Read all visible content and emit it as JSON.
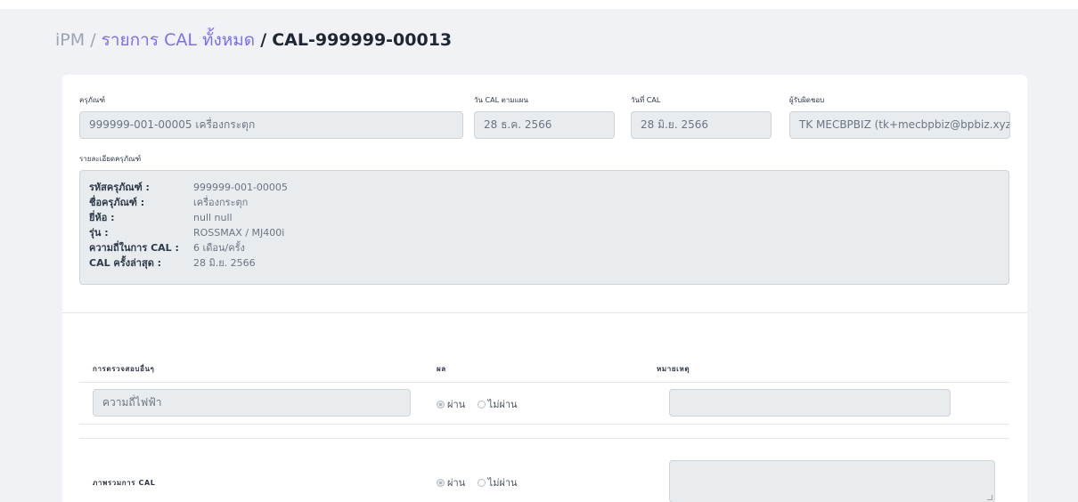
{
  "breadcrumb": {
    "root": "iPM",
    "separator": "/",
    "list_link": "รายการ CAL ทั้งหมด",
    "current": "CAL-999999-00013"
  },
  "equipment": {
    "label": "ครุภัณฑ์",
    "value": "999999-001-00005 เครื่องกระตุก"
  },
  "planned_date": {
    "label": "วัน CAL ตามแผน",
    "value": "28 ธ.ค. 2566"
  },
  "cal_date": {
    "label": "วันที่ CAL",
    "value": "28 มิ.ย. 2566"
  },
  "responsible": {
    "label": "ผู้รับผิดชอบ",
    "value": "TK MECBPBIZ (tk+mecbpbiz@bpbiz.xyz)"
  },
  "details": {
    "label": "รายละเอียดครุภัณฑ์",
    "rows": [
      {
        "label": "รหัสครุภัณฑ์ :",
        "value": "999999-001-00005"
      },
      {
        "label": "ชื่อครุภัณฑ์ :",
        "value": "เครื่องกระตุก"
      },
      {
        "label": "ยี่ห้อ :",
        "value": "null null"
      },
      {
        "label": "รุ่น :",
        "value": "ROSSMAX / MJ400i"
      },
      {
        "label": "ความถี่ในการ CAL :",
        "value": "6 เดือน/ครั้ง"
      },
      {
        "label": "CAL ครั้งล่าสุด :",
        "value": "28 มิ.ย. 2566"
      }
    ]
  },
  "inspection_table": {
    "headers": {
      "other_checks": "การตรวจสอบอื่นๆ",
      "result": "ผล",
      "remarks": "หมายเหตุ"
    },
    "row": {
      "item": "ความถี่ไฟฟ้า",
      "pass_label": "ผ่าน",
      "fail_label": "ไม่ผ่าน",
      "selected": "pass"
    }
  },
  "overall": {
    "label": "ภาพรวมการ CAL",
    "pass_label": "ผ่าน",
    "fail_label": "ไม่ผ่าน",
    "selected": "pass"
  },
  "colors": {
    "link": "#7a6ff0",
    "field_bg": "#e8ecef",
    "page_bg": "#f1f2f6"
  }
}
